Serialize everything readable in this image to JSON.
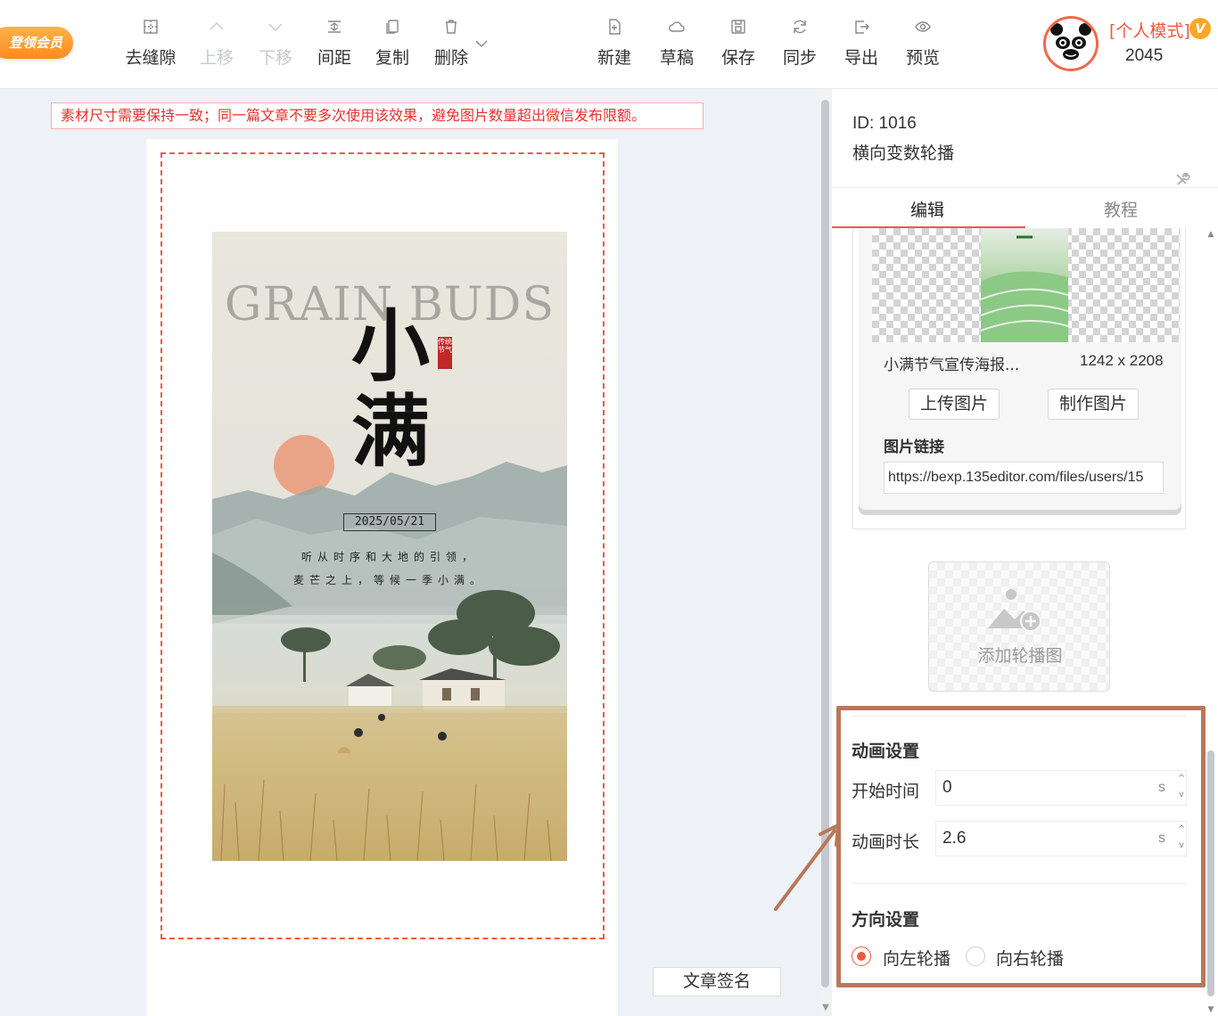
{
  "toolbar": {
    "vip_label": "登领会员",
    "left_tools": [
      {
        "label": "去缝隙",
        "icon": "grid-icon",
        "disabled": false
      },
      {
        "label": "上移",
        "icon": "chevron-up-icon",
        "disabled": true
      },
      {
        "label": "下移",
        "icon": "chevron-down-icon",
        "disabled": true
      },
      {
        "label": "间距",
        "icon": "spacing-icon",
        "disabled": false
      },
      {
        "label": "复制",
        "icon": "copy-icon",
        "disabled": false
      },
      {
        "label": "删除",
        "icon": "trash-icon",
        "disabled": false
      }
    ],
    "right_tools": [
      {
        "label": "新建",
        "icon": "new-file-icon"
      },
      {
        "label": "草稿",
        "icon": "cloud-icon"
      },
      {
        "label": "保存",
        "icon": "save-icon"
      },
      {
        "label": "同步",
        "icon": "sync-icon"
      },
      {
        "label": "导出",
        "icon": "export-icon"
      },
      {
        "label": "预览",
        "icon": "eye-icon"
      }
    ],
    "user": {
      "mode_label": "[个人模式]",
      "vip_letter": "V",
      "count": "2045"
    }
  },
  "editor": {
    "notice": "素材尺寸需要保持一致；同一篇文章不要多次使用该效果，避免图片数量超出微信发布限额。",
    "signature_button": "文章签名",
    "poster": {
      "title_en": "GRAIN BUDS",
      "title_cn_1": "小",
      "title_cn_2": "满",
      "seal_text": "传统节气",
      "date": "2025/05/21",
      "line_1": "听从时序和大地的引领，",
      "line_2": "麦芒之上，等候一季小满。"
    }
  },
  "panel": {
    "id_label": "ID: 1016",
    "template_name": "横向变数轮播",
    "tabs": {
      "edit": "编辑",
      "tutorial": "教程"
    },
    "image": {
      "file_name": "小满节气宣传海报...",
      "dimensions": "1242 x 2208",
      "upload_button": "上传图片",
      "make_button": "制作图片",
      "link_label": "图片链接",
      "link_value": "https://bexp.135editor.com/files/users/15"
    },
    "add_slide_label": "添加轮播图",
    "animation": {
      "title": "动画设置",
      "start_label": "开始时间",
      "start_value": "0",
      "duration_label": "动画时长",
      "duration_value": "2.6",
      "unit": "s"
    },
    "direction": {
      "title": "方向设置",
      "left_label": "向左轮播",
      "right_label": "向右轮播",
      "selected": "left"
    }
  },
  "colors": {
    "accent": "#f05a3c",
    "highlight": "#b8785a",
    "notice_text": "#e6322f"
  }
}
